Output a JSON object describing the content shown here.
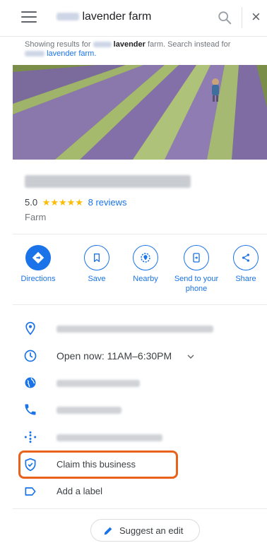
{
  "search": {
    "query": "lavender farm",
    "showing_prefix": "Showing results for",
    "showing_bold": "lavender",
    "showing_rest": "farm. Search instead for",
    "instead_link": "lavender farm."
  },
  "place": {
    "rating": "5.0",
    "stars": "★★★★★",
    "reviews": "8 reviews",
    "category": "Farm"
  },
  "actions": [
    {
      "label": "Directions",
      "icon": "directions-icon"
    },
    {
      "label": "Save",
      "icon": "bookmark-icon"
    },
    {
      "label": "Nearby",
      "icon": "nearby-icon"
    },
    {
      "label": "Send to your phone",
      "icon": "send-to-phone-icon"
    },
    {
      "label": "Share",
      "icon": "share-icon"
    }
  ],
  "hours": {
    "text": "Open now:  11AM–6:30PM"
  },
  "claim_label": "Claim this business",
  "label_label": "Add a label",
  "suggest_label": "Suggest an edit",
  "colors": {
    "accent": "#1a73e8",
    "star": "#fbbc04",
    "highlight": "#e8621c"
  }
}
